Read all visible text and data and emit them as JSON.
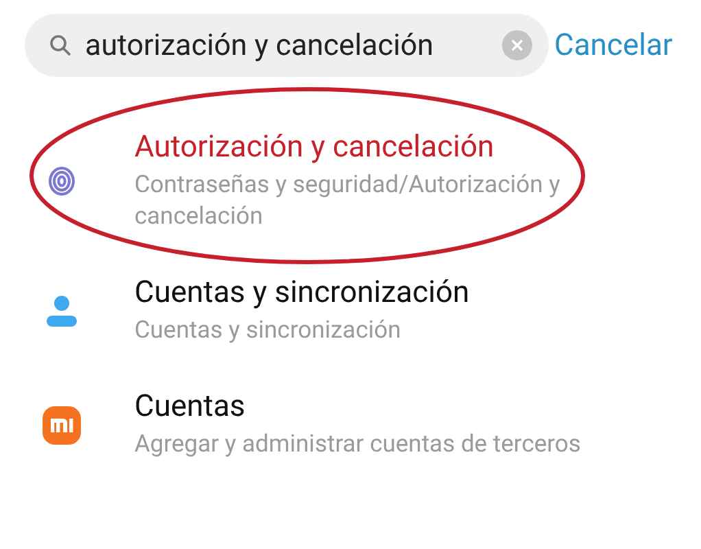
{
  "search": {
    "value": "autorización y cancelación",
    "cancel": "Cancelar"
  },
  "results": [
    {
      "kind": "fingerprint",
      "title": "Autorización y cancelación",
      "subtitle": "Contraseñas y seguridad/Autorización y cancelación",
      "highlighted": true,
      "circled": true
    },
    {
      "kind": "person",
      "title": "Cuentas y sincronización",
      "subtitle": "Cuentas y sincronización",
      "highlighted": false,
      "circled": false
    },
    {
      "kind": "brand",
      "title": "Cuentas",
      "subtitle": "Agregar y administrar cuentas de terceros",
      "highlighted": false,
      "circled": false
    }
  ]
}
